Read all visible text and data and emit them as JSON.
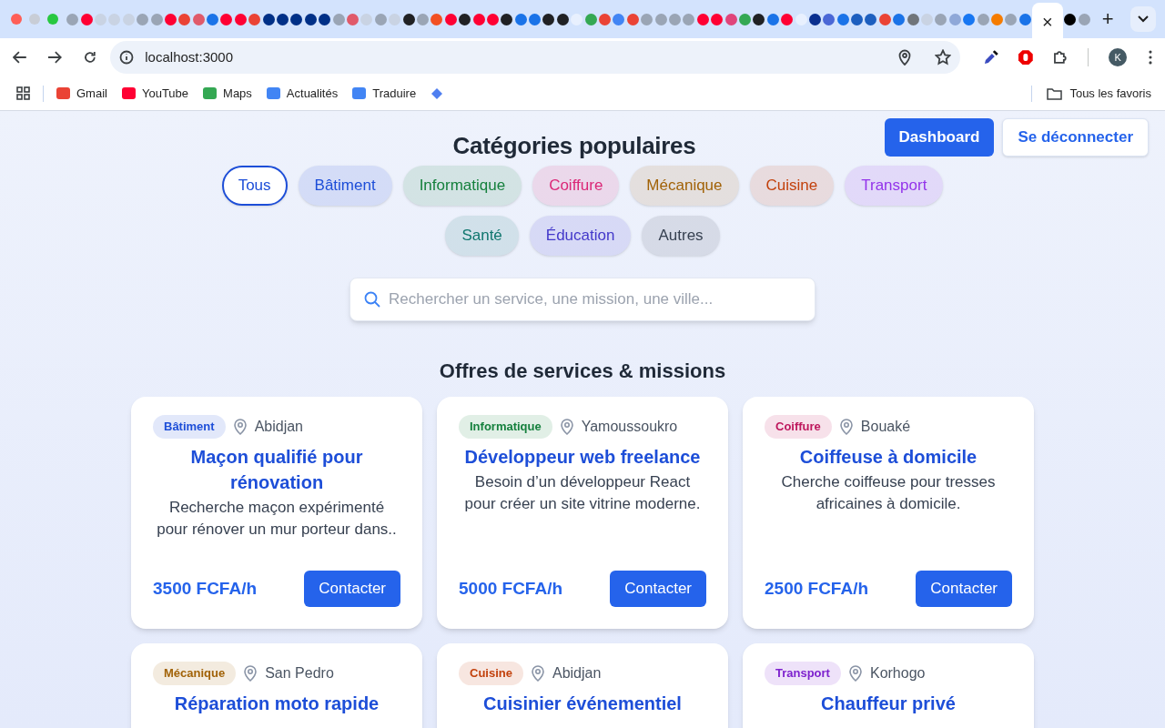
{
  "browser": {
    "tabs": [
      {
        "selected": false,
        "color": "#9aa5b5"
      },
      {
        "selected": false,
        "color": "#ff0033"
      },
      {
        "selected": false,
        "color": "#c9d3e3"
      },
      {
        "selected": false,
        "color": "#c9d3e3"
      },
      {
        "selected": false,
        "color": "#c9d3e3"
      },
      {
        "selected": false,
        "color": "#9aa5b5"
      },
      {
        "selected": false,
        "color": "#9aa5b5"
      },
      {
        "selected": false,
        "color": "#ff0033"
      },
      {
        "selected": false,
        "color": "#ea4335"
      },
      {
        "selected": false,
        "color": "#e05a6a"
      },
      {
        "selected": false,
        "color": "#1a73e8"
      },
      {
        "selected": false,
        "color": "#ff0033"
      },
      {
        "selected": false,
        "color": "#ff0033"
      },
      {
        "selected": false,
        "color": "#ea4335"
      },
      {
        "selected": false,
        "color": "#003087"
      },
      {
        "selected": false,
        "color": "#003087"
      },
      {
        "selected": false,
        "color": "#003087"
      },
      {
        "selected": false,
        "color": "#003087"
      },
      {
        "selected": false,
        "color": "#003087"
      },
      {
        "selected": false,
        "color": "#9aa5b5"
      },
      {
        "selected": false,
        "color": "#e05a6a"
      },
      {
        "selected": false,
        "color": "#c9d3e3"
      },
      {
        "selected": false,
        "color": "#9aa5b5"
      },
      {
        "selected": false,
        "color": "#c9d3e3"
      },
      {
        "selected": false,
        "color": "#202124"
      },
      {
        "selected": false,
        "color": "#9aa5b5"
      },
      {
        "selected": false,
        "color": "#f25022"
      },
      {
        "selected": false,
        "color": "#ff0033"
      },
      {
        "selected": false,
        "color": "#202124"
      },
      {
        "selected": false,
        "color": "#ff0033"
      },
      {
        "selected": false,
        "color": "#ff0033"
      },
      {
        "selected": false,
        "color": "#202124"
      },
      {
        "selected": false,
        "color": "#1a73e8"
      },
      {
        "selected": false,
        "color": "#1a73e8"
      },
      {
        "selected": false,
        "color": "#202124"
      },
      {
        "selected": false,
        "color": "#202124"
      },
      {
        "selected": false,
        "color": "#e8f0fe"
      },
      {
        "selected": false,
        "color": "#34a853"
      },
      {
        "selected": false,
        "color": "#ea4335"
      },
      {
        "selected": false,
        "color": "#4285f4"
      },
      {
        "selected": false,
        "color": "#ea4335"
      },
      {
        "selected": false,
        "color": "#9aa5b5"
      },
      {
        "selected": false,
        "color": "#9aa5b5"
      },
      {
        "selected": false,
        "color": "#9aa5b5"
      },
      {
        "selected": false,
        "color": "#9aa5b5"
      },
      {
        "selected": false,
        "color": "#ff0033"
      },
      {
        "selected": false,
        "color": "#ff0033"
      },
      {
        "selected": false,
        "color": "#e0457b"
      },
      {
        "selected": false,
        "color": "#34a853"
      },
      {
        "selected": false,
        "color": "#202124"
      },
      {
        "selected": false,
        "color": "#1a73e8"
      },
      {
        "selected": false,
        "color": "#ff0033"
      },
      {
        "selected": false,
        "color": "#e8f0fe"
      },
      {
        "selected": false,
        "color": "#0a2f8f"
      },
      {
        "selected": false,
        "color": "#4a67d6"
      },
      {
        "selected": false,
        "color": "#1a73e8"
      },
      {
        "selected": false,
        "color": "#1d5fbf"
      },
      {
        "selected": false,
        "color": "#1d5fbf"
      },
      {
        "selected": false,
        "color": "#ea4335"
      },
      {
        "selected": false,
        "color": "#1a73e8"
      },
      {
        "selected": false,
        "color": "#70757a"
      },
      {
        "selected": false,
        "color": "#c9d3e3"
      },
      {
        "selected": false,
        "color": "#9aa5b5"
      },
      {
        "selected": false,
        "color": "#8fa8d8"
      },
      {
        "selected": false,
        "color": "#1877f2"
      },
      {
        "selected": false,
        "color": "#9aa5b5"
      },
      {
        "selected": false,
        "color": "#f57c00"
      },
      {
        "selected": false,
        "color": "#9aa5b5"
      },
      {
        "selected": false,
        "color": "#1a73e8"
      },
      {
        "selected": true,
        "close": "×"
      },
      {
        "selected": false,
        "color": "#000000"
      },
      {
        "selected": false,
        "color": "#9aa5b5"
      }
    ],
    "new_tab": "+",
    "url": "localhost:3000",
    "avatar": "K",
    "bookmarks": [
      {
        "label": "Gmail",
        "color": "#ea4335"
      },
      {
        "label": "YouTube",
        "color": "#ff0033"
      },
      {
        "label": "Maps",
        "color": "#34a853"
      },
      {
        "label": "Actualités",
        "color": "#4285f4"
      },
      {
        "label": "Traduire",
        "color": "#4285f4"
      }
    ],
    "all_bookmarks": "Tous les favoris"
  },
  "page": {
    "title": "Catégories populaires",
    "buttons": [
      {
        "label": "Dashboard",
        "kind": "primary"
      },
      {
        "label": "Se déconnecter",
        "kind": "secondary"
      }
    ],
    "categories": [
      {
        "label": "Tous",
        "selected": true,
        "color": "#1d4ed8"
      },
      {
        "label": "Bâtiment",
        "selected": false,
        "color": "#1d4ed8"
      },
      {
        "label": "Informatique",
        "selected": false,
        "color": "#15803d"
      },
      {
        "label": "Coiffure",
        "selected": false,
        "color": "#db2777"
      },
      {
        "label": "Mécanique",
        "selected": false,
        "color": "#a16207"
      },
      {
        "label": "Cuisine",
        "selected": false,
        "color": "#c2410c"
      },
      {
        "label": "Transport",
        "selected": false,
        "color": "#9333ea"
      },
      {
        "label": "Santé",
        "selected": false,
        "color": "#0f766e"
      },
      {
        "label": "Éducation",
        "selected": false,
        "color": "#4338ca"
      },
      {
        "label": "Autres",
        "selected": false,
        "color": "#374151"
      }
    ],
    "search": {
      "placeholder": "Rechercher un service, une mission, une ville..."
    },
    "section_title": "Offres de services & missions",
    "offers": [
      {
        "tag": "Bâtiment",
        "color": "#1d4ed8",
        "city": "Abidjan",
        "title": "Maçon qualifié pour rénovation",
        "description": "Recherche maçon expérimenté pour rénover un mur porteur dans..",
        "price": "3500 FCFA/h",
        "action": "Contacter"
      },
      {
        "tag": "Informatique",
        "color": "#15803d",
        "city": "Yamoussoukro",
        "title": "Développeur web freelance",
        "description": "Besoin d’un développeur React pour créer un site vitrine moderne.",
        "price": "5000 FCFA/h",
        "action": "Contacter"
      },
      {
        "tag": "Coiffure",
        "color": "#be185d",
        "city": "Bouaké",
        "title": "Coiffeuse à domicile",
        "description": "Cherche coiffeuse pour tresses africaines à domicile.",
        "price": "2500 FCFA/h",
        "action": "Contacter"
      },
      {
        "tag": "Mécanique",
        "color": "#a16207",
        "city": "San Pedro",
        "title": "Réparation moto rapide"
      },
      {
        "tag": "Cuisine",
        "color": "#c2410c",
        "city": "Abidjan",
        "title": "Cuisinier événementiel"
      },
      {
        "tag": "Transport",
        "color": "#7e22ce",
        "city": "Korhogo",
        "title": "Chauffeur privé"
      }
    ]
  }
}
